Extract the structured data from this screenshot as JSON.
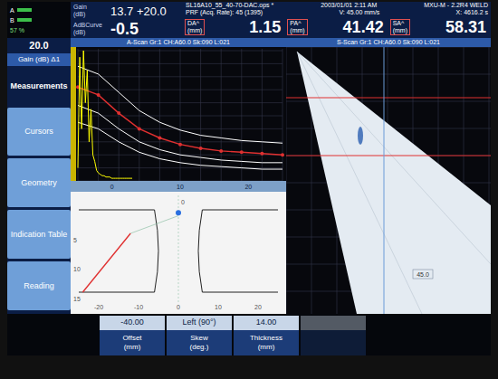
{
  "status": {
    "channels": [
      "A",
      "B"
    ],
    "battery": "57 %"
  },
  "header": {
    "file": "SL16A10_55_40-70-DAC.ops *",
    "date": "2003/01/01 2:11 AM",
    "model": "MXU-M - 2.2R4 WELD",
    "prf": "PRF (Acq. Rate): 45 (1395)",
    "velocity": "V: 45.00 mm/s",
    "time": "X: 4616.2 s"
  },
  "fields": [
    {
      "label": "Gain",
      "unit": "(dB)",
      "value": "13.7 +20.0"
    },
    {
      "label": "AdBCurve",
      "unit": "(dB)",
      "value": "-0.5"
    }
  ],
  "readings": [
    {
      "label": "DA^",
      "unit": "(mm)",
      "value": "1.15"
    },
    {
      "label": "PA^",
      "unit": "(mm)",
      "value": "41.42"
    },
    {
      "label": "SA^",
      "unit": "(mm)",
      "value": "58.31"
    }
  ],
  "sidebar": {
    "value": "20.0",
    "label": "Gain (dB) Δ1",
    "items": [
      {
        "label": "Measurements",
        "selected": true
      },
      {
        "label": "Cursors",
        "selected": false
      },
      {
        "label": "Geometry",
        "selected": false
      },
      {
        "label": "Indication Table",
        "selected": false
      },
      {
        "label": "Reading",
        "selected": false
      }
    ]
  },
  "a_scan": {
    "title": "A-Scan Gr:1 CH:A60.0 Sk:090 L:021",
    "ticks": [
      "0",
      "10",
      "20"
    ],
    "series": [
      {
        "name": "reference",
        "kind": "curve",
        "color": "#ffffff",
        "values": [
          88,
          82,
          68,
          54,
          45,
          39,
          35,
          33,
          31,
          30,
          29
        ]
      },
      {
        "name": "dac",
        "kind": "dac",
        "color": "#e03030",
        "values": [
          72,
          66,
          52,
          40,
          33,
          28,
          25,
          23,
          22,
          21,
          20
        ]
      },
      {
        "name": "minus-6",
        "kind": "curve",
        "color": "#ffffff",
        "values": [
          58,
          52,
          40,
          30,
          24,
          20,
          18,
          16,
          15,
          14,
          14
        ]
      },
      {
        "name": "minus-12",
        "kind": "curve",
        "color": "#ffffff",
        "values": [
          45,
          40,
          30,
          22,
          17,
          14,
          12,
          11,
          10,
          9,
          9
        ]
      },
      {
        "name": "signal",
        "kind": "signal",
        "color": "#ffff00",
        "values": [
          10,
          95,
          40,
          100,
          60,
          85,
          30,
          55,
          20,
          15,
          8,
          6,
          5,
          4,
          4,
          3,
          3,
          3,
          2,
          2,
          2,
          2,
          2,
          2,
          2,
          2,
          2,
          2,
          2,
          2
        ]
      }
    ]
  },
  "diagram": {
    "top_label": "0",
    "x_ticks": [
      "-20",
      "-10",
      "0",
      "10",
      "20"
    ],
    "y_ticks": [
      "5",
      "10",
      "15"
    ]
  },
  "s_scan": {
    "title": "S-Scan Gr:1 CH:A60.0 Sk:090 L:021",
    "angle_label": "45.0"
  },
  "params": [
    {
      "value": "-40.00",
      "label": "Offset",
      "unit": "(mm)"
    },
    {
      "value": "Left (90°)",
      "label": "Skew",
      "unit": "(deg.)"
    },
    {
      "value": "14.00",
      "label": "Thickness",
      "unit": "(mm)"
    }
  ]
}
